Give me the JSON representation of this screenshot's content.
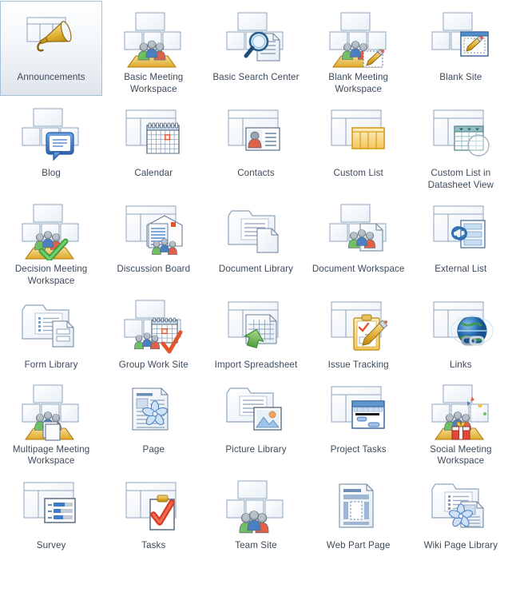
{
  "gallery": {
    "name": "template-gallery",
    "selected_index": 0,
    "columns": 5,
    "label_color": "#3c4a5a",
    "selection_border_color": "#a6c0d6",
    "selection_background": "#eef2f7",
    "items": [
      {
        "label": "Announcements",
        "icon": "announcements-icon",
        "selected": true
      },
      {
        "label": "Basic Meeting Workspace",
        "icon": "basic-meeting-workspace-icon",
        "selected": false
      },
      {
        "label": "Basic Search Center",
        "icon": "basic-search-center-icon",
        "selected": false
      },
      {
        "label": "Blank Meeting Workspace",
        "icon": "blank-meeting-workspace-icon",
        "selected": false
      },
      {
        "label": "Blank Site",
        "icon": "blank-site-icon",
        "selected": false
      },
      {
        "label": "Blog",
        "icon": "blog-icon",
        "selected": false
      },
      {
        "label": "Calendar",
        "icon": "calendar-icon",
        "selected": false
      },
      {
        "label": "Contacts",
        "icon": "contacts-icon",
        "selected": false
      },
      {
        "label": "Custom List",
        "icon": "custom-list-icon",
        "selected": false
      },
      {
        "label": "Custom List in Datasheet View",
        "icon": "custom-list-datasheet-icon",
        "selected": false
      },
      {
        "label": "Decision Meeting Workspace",
        "icon": "decision-meeting-workspace-icon",
        "selected": false
      },
      {
        "label": "Discussion Board",
        "icon": "discussion-board-icon",
        "selected": false
      },
      {
        "label": "Document Library",
        "icon": "document-library-icon",
        "selected": false
      },
      {
        "label": "Document Workspace",
        "icon": "document-workspace-icon",
        "selected": false
      },
      {
        "label": "External List",
        "icon": "external-list-icon",
        "selected": false
      },
      {
        "label": "Form Library",
        "icon": "form-library-icon",
        "selected": false
      },
      {
        "label": "Group Work Site",
        "icon": "group-work-site-icon",
        "selected": false
      },
      {
        "label": "Import Spreadsheet",
        "icon": "import-spreadsheet-icon",
        "selected": false
      },
      {
        "label": "Issue Tracking",
        "icon": "issue-tracking-icon",
        "selected": false
      },
      {
        "label": "Links",
        "icon": "links-icon",
        "selected": false
      },
      {
        "label": "Multipage Meeting Workspace",
        "icon": "multipage-meeting-workspace-icon",
        "selected": false
      },
      {
        "label": "Page",
        "icon": "page-icon",
        "selected": false
      },
      {
        "label": "Picture Library",
        "icon": "picture-library-icon",
        "selected": false
      },
      {
        "label": "Project Tasks",
        "icon": "project-tasks-icon",
        "selected": false
      },
      {
        "label": "Social Meeting Workspace",
        "icon": "social-meeting-workspace-icon",
        "selected": false
      },
      {
        "label": "Survey",
        "icon": "survey-icon",
        "selected": false
      },
      {
        "label": "Tasks",
        "icon": "tasks-icon",
        "selected": false
      },
      {
        "label": "Team Site",
        "icon": "team-site-icon",
        "selected": false
      },
      {
        "label": "Web Part Page",
        "icon": "web-part-page-icon",
        "selected": false
      },
      {
        "label": "Wiki Page Library",
        "icon": "wiki-page-library-icon",
        "selected": false
      }
    ]
  }
}
